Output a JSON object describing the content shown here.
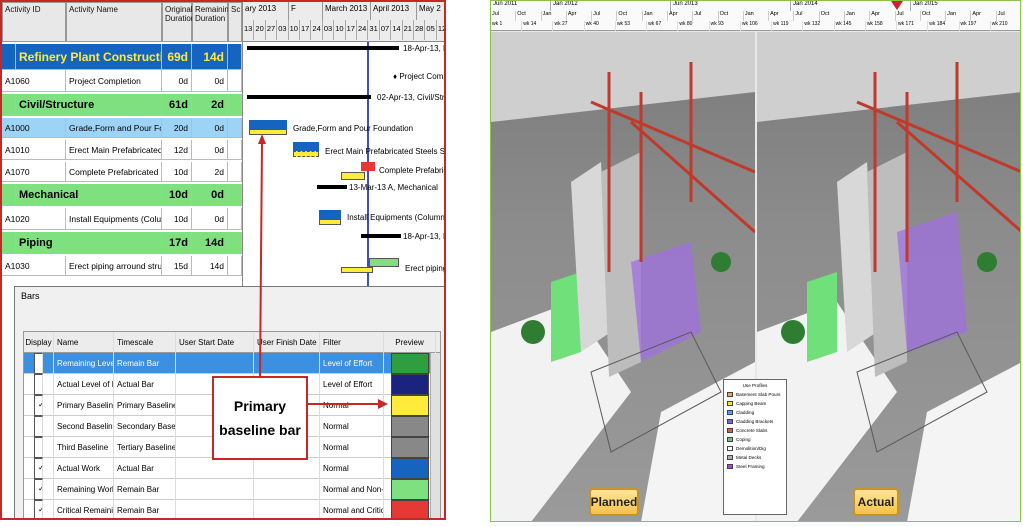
{
  "colors": {
    "accent_red": "#c62828",
    "wbs_blue": "#1565c0",
    "wbs_green": "#7fe07f",
    "selected": "#9dd3f5",
    "badge": "#f7c14a"
  },
  "activity_table": {
    "headers": [
      "Activity ID",
      "Activity Name",
      "Original Duration",
      "Remaining Duration",
      "Sc"
    ],
    "rows": [
      {
        "type": "wbs1",
        "id": "",
        "name": "Refinery Plant Constructio",
        "orig": "69d",
        "rem": "14d"
      },
      {
        "type": "act",
        "id": "A1060",
        "name": "Project Completion",
        "orig": "0d",
        "rem": "0d"
      },
      {
        "type": "wbs2",
        "id": "",
        "name": "Civil/Structure",
        "orig": "61d",
        "rem": "2d"
      },
      {
        "type": "sel",
        "id": "A1000",
        "name": "Grade,Form and Pour Found",
        "orig": "20d",
        "rem": "0d"
      },
      {
        "type": "act",
        "id": "A1010",
        "name": "Erect Main Prefabricated St",
        "orig": "12d",
        "rem": "0d"
      },
      {
        "type": "act",
        "id": "A1070",
        "name": "Complete Prefabricated Stee",
        "orig": "10d",
        "rem": "2d"
      },
      {
        "type": "wbs2",
        "id": "",
        "name": "Mechanical",
        "orig": "10d",
        "rem": "0d"
      },
      {
        "type": "act",
        "id": "A1020",
        "name": "Install Equipments (Columns",
        "orig": "10d",
        "rem": "0d"
      },
      {
        "type": "wbs2",
        "id": "",
        "name": "Piping",
        "orig": "17d",
        "rem": "14d"
      },
      {
        "type": "act",
        "id": "A1030",
        "name": "Erect piping arround structu",
        "orig": "15d",
        "rem": "14d"
      }
    ]
  },
  "gantt": {
    "months": [
      "ary 2013",
      "F",
      "March 2013",
      "April 2013",
      "May 2"
    ],
    "days": [
      "13",
      "20",
      "27",
      "03",
      "10",
      "17",
      "24",
      "03",
      "10",
      "17",
      "24",
      "31",
      "07",
      "14",
      "21",
      "28",
      "05",
      "12"
    ],
    "labels": [
      "18-Apr-13, Re",
      "Project Compl",
      "02-Apr-13, Civil/Structure",
      "Grade,Form and Pour Foundation",
      "Erect Main Prefabricated Steels Structu",
      "Complete Prefabricati",
      "13-Mar-13 A, Mechanical",
      "Install Equipments (Columns, Re",
      "18-Apr-13, Pi",
      "Erect piping a"
    ]
  },
  "bars_dialog": {
    "title": "Bars",
    "columns": [
      "Display",
      "Name",
      "Timescale",
      "User Start Date",
      "User Finish Date",
      "Filter",
      "Preview"
    ],
    "rows": [
      {
        "checked": false,
        "name": "Remaining Level of",
        "timescale": "Remain Bar",
        "filter": "Level of Effort",
        "color": "#2e9e3e",
        "selected": true
      },
      {
        "checked": false,
        "name": "Actual Level of E",
        "timescale": "Actual Bar",
        "filter": "Level of Effort",
        "color": "#1a237e",
        "selected": false
      },
      {
        "checked": true,
        "name": "Primary Baseline",
        "timescale": "Primary Baseline B",
        "filter": "Normal",
        "color": "#ffeb3b",
        "selected": false
      },
      {
        "checked": false,
        "name": "Second Baseline",
        "timescale": "Secondary Baseli",
        "filter": "Normal",
        "color": "#888888",
        "selected": false
      },
      {
        "checked": false,
        "name": "Third Baseline",
        "timescale": "Tertiary Baseline E",
        "filter": "Normal",
        "color": "#888888",
        "selected": false
      },
      {
        "checked": true,
        "name": "Actual Work",
        "timescale": "Actual Bar",
        "filter": "Normal",
        "color": "#1565c0",
        "selected": false
      },
      {
        "checked": true,
        "name": "Remaining Work",
        "timescale": "Remain Bar",
        "filter": "Normal and Non-cri",
        "color": "#7fe07f",
        "selected": false
      },
      {
        "checked": true,
        "name": "Critical Remaining",
        "timescale": "Remain Bar",
        "filter": "Normal and Critical",
        "color": "#e53935",
        "selected": false
      }
    ],
    "callout_line1": "Primary",
    "callout_line2": "baseline bar"
  },
  "timeline": {
    "years": [
      "Jun 2011",
      "Jan 2012",
      "Jun 2013",
      "Jan 2014",
      "Jan 2015"
    ],
    "months": [
      "Jul",
      "Oct",
      "Jan",
      "Apr",
      "Jul",
      "Oct",
      "Jan",
      "Apr",
      "Jul",
      "Oct",
      "Jan",
      "Apr",
      "Jul",
      "Oct",
      "Jan",
      "Apr",
      "Jul",
      "Oct",
      "Jan",
      "Apr",
      "Jul"
    ],
    "weeks": [
      "wk 1",
      "wk 14",
      "wk 27",
      "wk 40",
      "wk 53",
      "wk 67",
      "wk 80",
      "wk 93",
      "wk 106",
      "wk 119",
      "wk 132",
      "wk 145",
      "wk 158",
      "wk 171",
      "wk 184",
      "wk 197",
      "wk 210"
    ]
  },
  "views": {
    "planned": "Planned",
    "actual": "Actual"
  },
  "legend": {
    "title": "Use Profiles",
    "items": [
      {
        "label": "Basement Slab Pours",
        "color": "#f0a35a"
      },
      {
        "label": "Capping Beam",
        "color": "#f5e04a"
      },
      {
        "label": "Cladding",
        "color": "#4aa3f0"
      },
      {
        "label": "Cladding Brackets",
        "color": "#7a5af0"
      },
      {
        "label": "Concrete Slabs",
        "color": "#e05a4a"
      },
      {
        "label": "Coping",
        "color": "#66cc66"
      },
      {
        "label": "Demolition/Dig",
        "color": "#ffffff"
      },
      {
        "label": "Metal Decks",
        "color": "#b0b0b0"
      },
      {
        "label": "Steel Framing",
        "color": "#9b4ae0"
      }
    ]
  }
}
